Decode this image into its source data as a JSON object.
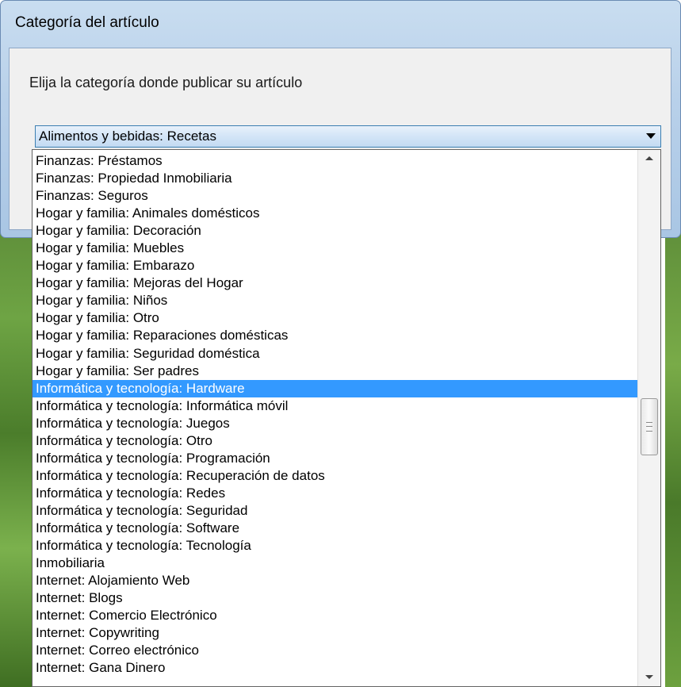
{
  "window": {
    "title": "Categoría del artículo"
  },
  "prompt": "Elija la categoría donde publicar su artículo",
  "combo": {
    "selected": "Alimentos y bebidas: Recetas"
  },
  "list": {
    "items": [
      "Finanzas: Préstamos",
      "Finanzas: Propiedad Inmobiliaria",
      "Finanzas: Seguros",
      "Hogar y familia: Animales domésticos",
      "Hogar y familia: Decoración",
      "Hogar y familia: Muebles",
      "Hogar y familia: Embarazo",
      "Hogar y familia: Mejoras del Hogar",
      "Hogar y familia: Niños",
      "Hogar y familia: Otro",
      "Hogar y familia: Reparaciones domésticas",
      "Hogar y familia: Seguridad doméstica",
      "Hogar y familia: Ser padres",
      "Informática y tecnología: Hardware",
      "Informática y tecnología: Informática móvil",
      "Informática y tecnología: Juegos",
      "Informática y tecnología: Otro",
      "Informática y tecnología: Programación",
      "Informática y tecnología: Recuperación de datos",
      "Informática y tecnología: Redes",
      "Informática y tecnología: Seguridad",
      "Informática y tecnología: Software",
      "Informática y tecnología: Tecnología",
      "Inmobiliaria",
      "Internet: Alojamiento Web",
      "Internet: Blogs",
      "Internet: Comercio Electrónico",
      "Internet: Copywriting",
      "Internet: Correo electrónico",
      "Internet: Gana Dinero"
    ],
    "highlighted": "Informática y tecnología: Hardware"
  },
  "icons": {
    "combo_arrow": "chevron-down-icon",
    "scroll_up": "scroll-up-arrow-icon",
    "scroll_down": "scroll-down-arrow-icon",
    "thumb_grip": "grip-icon"
  },
  "colors": {
    "selection": "#3399ff",
    "combo_border": "#3c7fb1"
  }
}
